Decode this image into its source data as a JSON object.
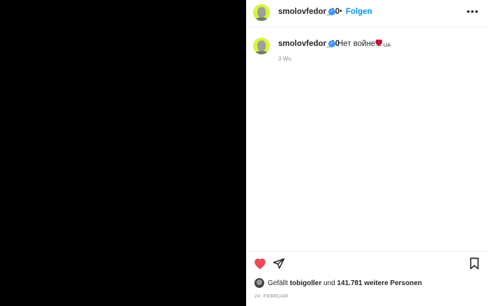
{
  "header": {
    "username": "smolovfedor_10",
    "verified_glyph": "✓",
    "separator": "•",
    "follow_label": "Folgen",
    "more_label": "•••"
  },
  "caption": {
    "username": "smolovfedor_10",
    "verified_glyph": "✓",
    "text": "Нет войне!!!",
    "emoji": "red-heart-icon",
    "flag_text": "UA",
    "time": "3 Wo."
  },
  "actions": {
    "like_icon": "heart-filled-icon",
    "share_icon": "paper-plane-icon",
    "save_icon": "bookmark-icon",
    "like_color": "#ed4956"
  },
  "likes": {
    "prefix": "Gefällt",
    "user": "tobigoller",
    "middle": "und",
    "count": "141.781 weitere Personen"
  },
  "date": "24. FEBRUAR",
  "colors": {
    "avatar_bg": "#d8f53a",
    "accent": "#0095f6",
    "verified": "#3897f0",
    "media_bg": "#000000"
  }
}
